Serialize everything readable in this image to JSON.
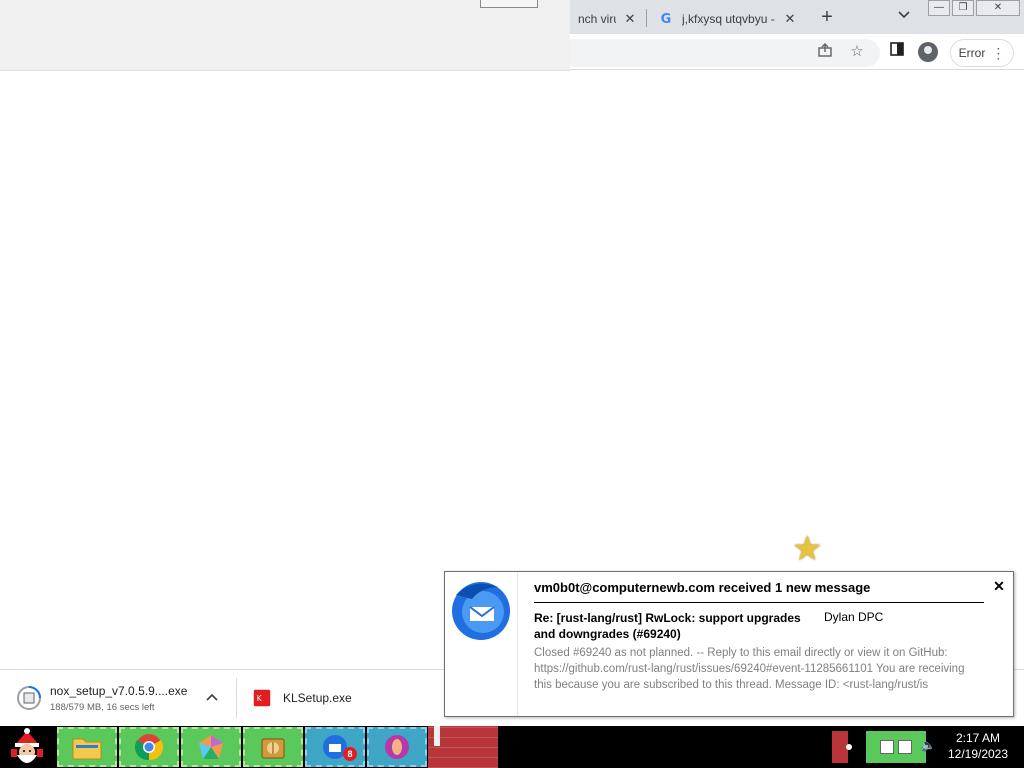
{
  "browser": {
    "tabs": [
      {
        "title": "nch virus"
      },
      {
        "title": "j,kfxysq utqvbyu -"
      }
    ],
    "new_tab_symbol": "+",
    "error_button_label": "Error",
    "icons": [
      "share-icon",
      "star-icon",
      "side-panel-icon",
      "profile-icon",
      "menu-icon"
    ]
  },
  "downloads": [
    {
      "filename": "nox_setup_v7.0.5.9....exe",
      "status": "188/579 MB, 16 secs left"
    },
    {
      "filename": "KLSetup.exe"
    }
  ],
  "notification": {
    "title": "vm0b0t@computernewb.com received 1 new message",
    "subject": "Re: [rust-lang/rust] RwLock: support upgrades and downgrades (#69240)",
    "sender": "Dylan DPC",
    "body": "Closed #69240 as not planned. -- Reply to this email directly or view it on GitHub: https://github.com/rust-lang/rust/issues/69240#event-11285661101 You are receiving this because you are subscribed to this thread. Message ID: <rust-lang/rust/is",
    "close_symbol": "✕"
  },
  "taskbar": {
    "apps": [
      "file-explorer",
      "chrome",
      "app-pinwheel",
      "app-archive",
      "thunderbird",
      "opera"
    ],
    "thunderbird_badge": "8",
    "time": "2:17 AM",
    "date": "12/19/2023"
  },
  "colors": {
    "taskbar_bg": "#000000",
    "taskbar_app_green": "#5ac85a",
    "brick_red": "#b8363a"
  }
}
